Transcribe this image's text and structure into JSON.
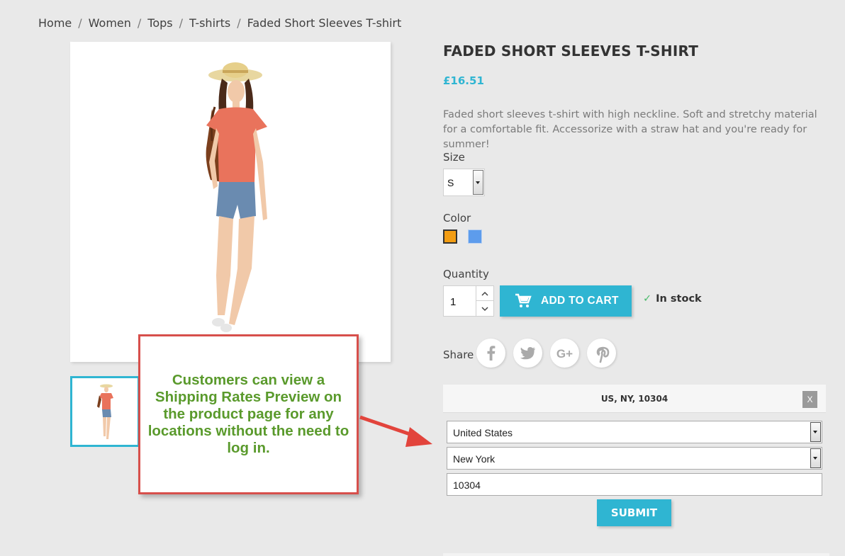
{
  "breadcrumb": {
    "items": [
      "Home",
      "Women",
      "Tops",
      "T-shirts",
      "Faded Short Sleeves T-shirt"
    ],
    "separator": "/"
  },
  "product": {
    "title": "FADED SHORT SLEEVES T-SHIRT",
    "price": "£16.51",
    "description": "Faded short sleeves t-shirt with high neckline. Soft and stretchy material for a comfortable fit. Accessorize with a straw hat and you're ready for summer!"
  },
  "size": {
    "label": "Size",
    "selected": "S"
  },
  "color": {
    "label": "Color",
    "swatches": [
      {
        "name": "Orange",
        "hex": "#f39d13",
        "selected": true
      },
      {
        "name": "Blue",
        "hex": "#5d9cec",
        "selected": false
      }
    ]
  },
  "quantity": {
    "label": "Quantity",
    "value": "1",
    "up_icon": "chevron-up-icon",
    "down_icon": "chevron-down-icon"
  },
  "cart": {
    "button_label": "ADD TO CART",
    "icon": "cart-icon",
    "stock_check": "✓",
    "stock_label": "In stock"
  },
  "share": {
    "label": "Share",
    "networks": [
      "facebook-icon",
      "twitter-icon",
      "google-plus-icon",
      "pinterest-icon"
    ]
  },
  "shipping": {
    "location_summary": "US, NY, 10304",
    "close_label": "X",
    "country": "United States",
    "state": "New York",
    "zip": "10304",
    "submit_label": "SUBMIT"
  },
  "callout": {
    "text": "Customers can view a Shipping Rates Preview on the product page for any locations without the need to log in."
  },
  "colors": {
    "accent": "#2fb5d2",
    "callout_border": "#d74f4b",
    "callout_text": "#5a9a2c",
    "stock_check": "#4cbb6c",
    "background": "#e9e9e9"
  }
}
